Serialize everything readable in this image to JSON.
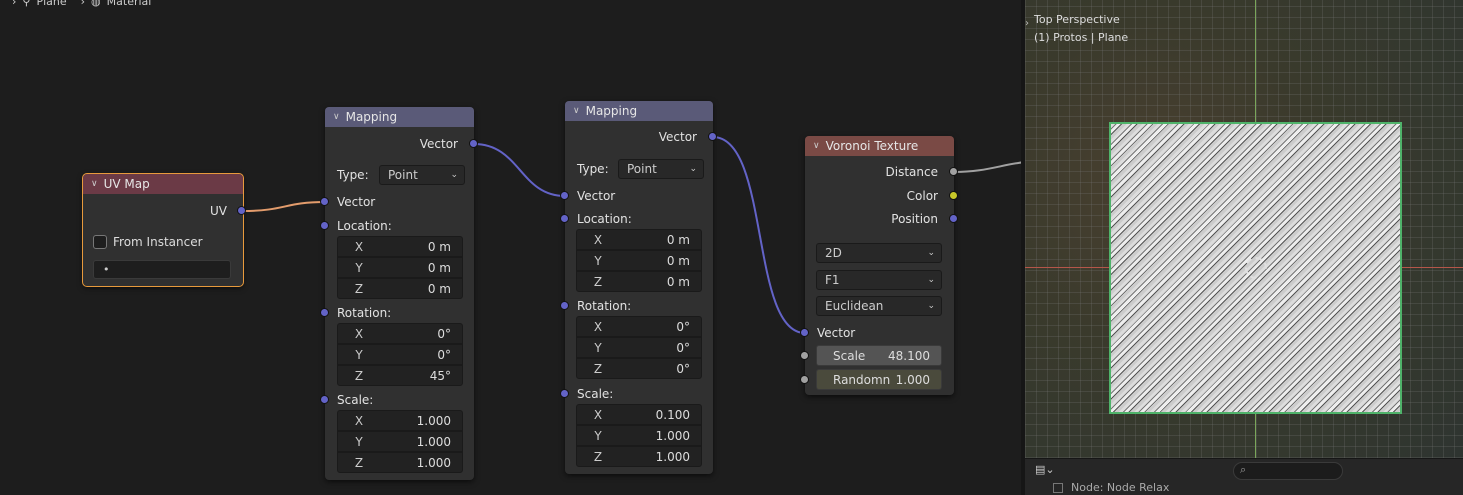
{
  "breadcrumb": {
    "item1": "Plane",
    "item2": "Material"
  },
  "colors": {
    "uvmap_header": "#6b3a46",
    "mapping_header": "#5a5a78",
    "voronoi_header": "#7a4a45",
    "vector_socket": "#6363c7",
    "color_socket": "#c7c729",
    "float_socket": "#a1a1a1",
    "uv_wire": "#e39c6c",
    "vector_wire": "#6363c7"
  },
  "uvmap": {
    "title": "UV Map",
    "output": "UV",
    "from_instancer": "From Instancer",
    "uv_value": "•"
  },
  "mapping1": {
    "title": "Mapping",
    "output": "Vector",
    "type_label": "Type:",
    "type_value": "Point",
    "input_vector": "Vector",
    "location_label": "Location:",
    "location": [
      {
        "axis": "X",
        "value": "0 m"
      },
      {
        "axis": "Y",
        "value": "0 m"
      },
      {
        "axis": "Z",
        "value": "0 m"
      }
    ],
    "rotation_label": "Rotation:",
    "rotation": [
      {
        "axis": "X",
        "value": "0°"
      },
      {
        "axis": "Y",
        "value": "0°"
      },
      {
        "axis": "Z",
        "value": "45°"
      }
    ],
    "scale_label": "Scale:",
    "scale": [
      {
        "axis": "X",
        "value": "1.000"
      },
      {
        "axis": "Y",
        "value": "1.000"
      },
      {
        "axis": "Z",
        "value": "1.000"
      }
    ]
  },
  "mapping2": {
    "title": "Mapping",
    "output": "Vector",
    "type_label": "Type:",
    "type_value": "Point",
    "input_vector": "Vector",
    "location_label": "Location:",
    "location": [
      {
        "axis": "X",
        "value": "0 m"
      },
      {
        "axis": "Y",
        "value": "0 m"
      },
      {
        "axis": "Z",
        "value": "0 m"
      }
    ],
    "rotation_label": "Rotation:",
    "rotation": [
      {
        "axis": "X",
        "value": "0°"
      },
      {
        "axis": "Y",
        "value": "0°"
      },
      {
        "axis": "Z",
        "value": "0°"
      }
    ],
    "scale_label": "Scale:",
    "scale": [
      {
        "axis": "X",
        "value": "0.100"
      },
      {
        "axis": "Y",
        "value": "1.000"
      },
      {
        "axis": "Z",
        "value": "1.000"
      }
    ]
  },
  "voronoi": {
    "title": "Voronoi Texture",
    "out_distance": "Distance",
    "out_color": "Color",
    "out_position": "Position",
    "dim": "2D",
    "feature": "F1",
    "metric": "Euclidean",
    "input_vector": "Vector",
    "scale_label": "Scale",
    "scale_value": "48.100",
    "random_label": "Randomn",
    "random_value": "1.000"
  },
  "viewport": {
    "view_name": "Top Perspective",
    "object_info": "(1) Protos | Plane"
  },
  "outliner": {
    "item": "Node: Node Relax"
  }
}
